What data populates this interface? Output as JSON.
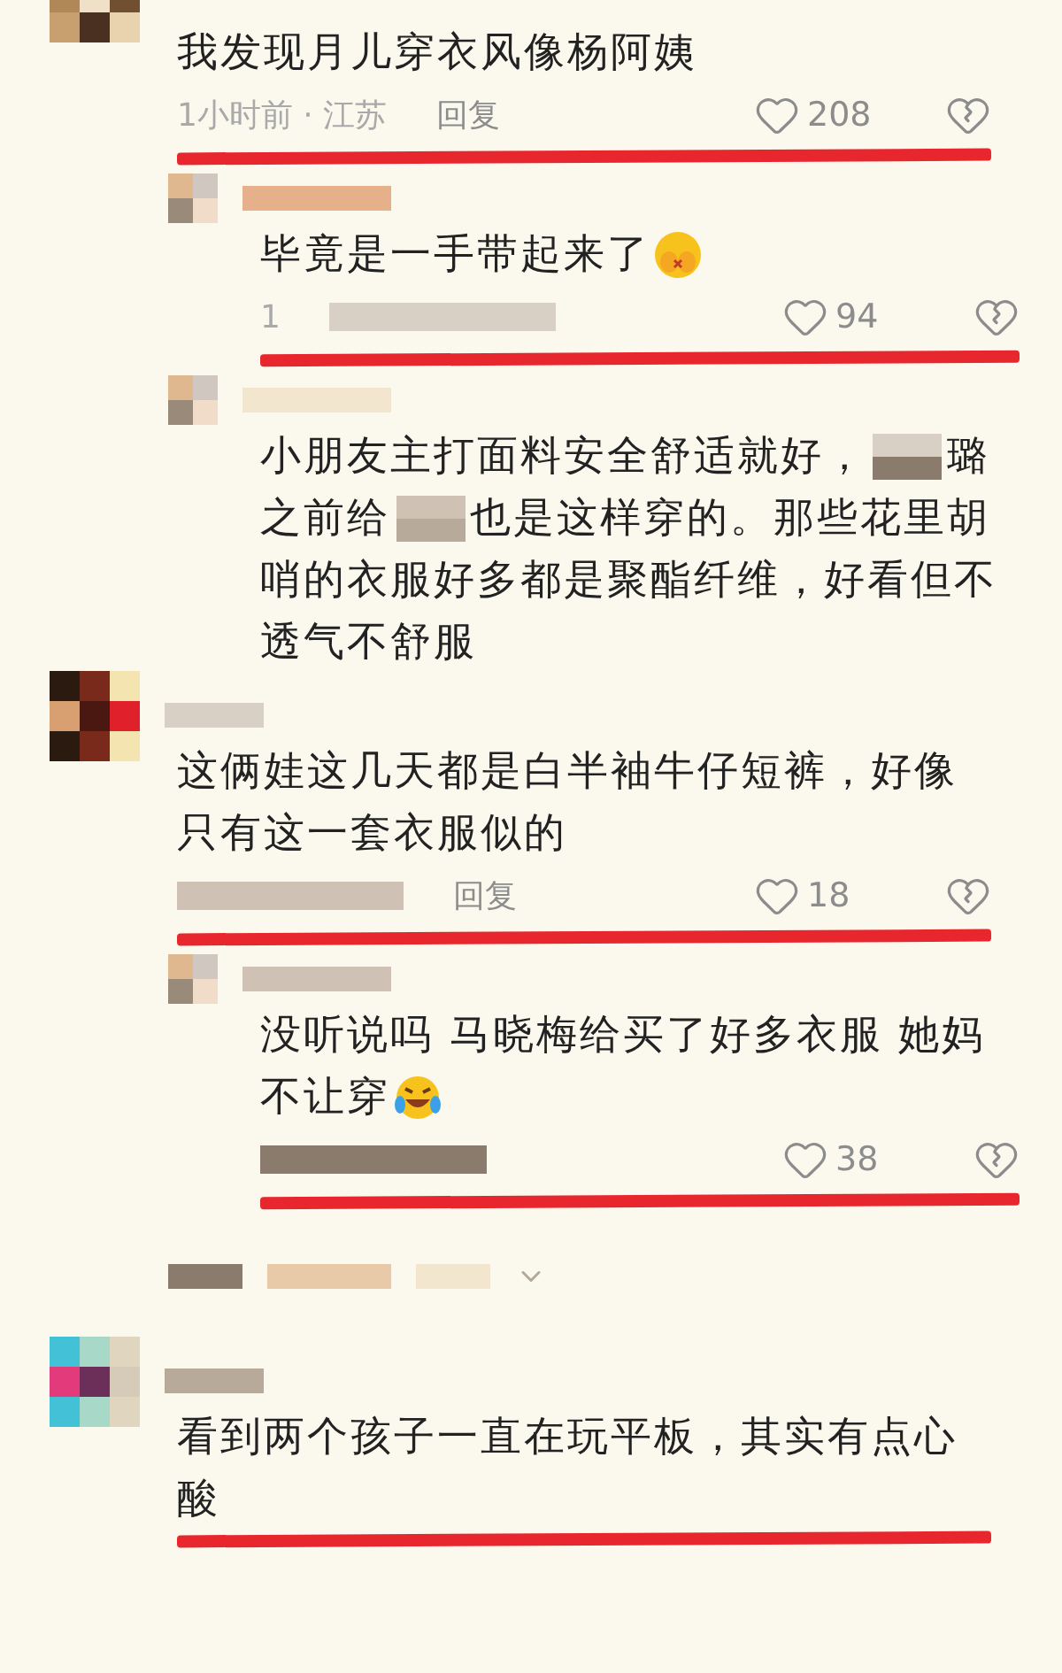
{
  "comments": [
    {
      "kind": "comment",
      "lines": [
        [
          {
            "kind": "text",
            "text": "我发现月儿穿衣风像杨阿姨"
          }
        ]
      ],
      "meta": [
        {
          "kind": "text",
          "text": "1小时前 · 江苏"
        },
        {
          "kind": "reply",
          "text": "回复"
        }
      ],
      "likes": "208",
      "underlined": true
    },
    {
      "kind": "reply",
      "lines": [
        [
          {
            "kind": "text",
            "text": "毕竟是一手带起来了"
          },
          {
            "kind": "hiding"
          }
        ]
      ],
      "meta": [
        {
          "kind": "text",
          "text": "1"
        },
        {
          "kind": "mosaic"
        }
      ],
      "likes": "94",
      "underlined": true
    },
    {
      "kind": "reply",
      "lines": [
        [
          {
            "kind": "text",
            "text": "小朋友主打面料安全舒适就好，"
          },
          {
            "kind": "mosaic"
          },
          {
            "kind": "text",
            "text": "璐"
          }
        ],
        [
          {
            "kind": "text",
            "text": "之前给"
          },
          {
            "kind": "mosaic"
          },
          {
            "kind": "text",
            "text": "也是这样穿的。那些花里胡"
          }
        ],
        [
          {
            "kind": "text",
            "text": "哨的衣服好多都是聚酯纤维，好看但不"
          }
        ],
        [
          {
            "kind": "text",
            "text": "透气不舒服"
          }
        ]
      ],
      "underlined": false
    },
    {
      "kind": "comment",
      "lines": [
        [
          {
            "kind": "text",
            "text": "这俩娃这几天都是白半袖牛仔短裤，好像"
          }
        ],
        [
          {
            "kind": "text",
            "text": "只有这一套衣服似的"
          }
        ]
      ],
      "meta": [
        {
          "kind": "mosaic"
        },
        {
          "kind": "reply",
          "text": "回复"
        }
      ],
      "likes": "18",
      "underlined": true
    },
    {
      "kind": "reply",
      "lines": [
        [
          {
            "kind": "text",
            "text": "没听说吗 马晓梅给买了好多衣服 她妈"
          }
        ],
        [
          {
            "kind": "text",
            "text": "不让穿"
          },
          {
            "kind": "laughing"
          }
        ]
      ],
      "meta": [
        {
          "kind": "mosaic"
        }
      ],
      "likes": "38",
      "underlined": true
    },
    {
      "kind": "collapsed"
    },
    {
      "kind": "comment",
      "lines": [
        [
          {
            "kind": "text",
            "text": "看到两个孩子一直在玩平板，其实有点心"
          }
        ],
        [
          {
            "kind": "text",
            "text": "酸"
          }
        ]
      ],
      "underlined": true
    }
  ]
}
